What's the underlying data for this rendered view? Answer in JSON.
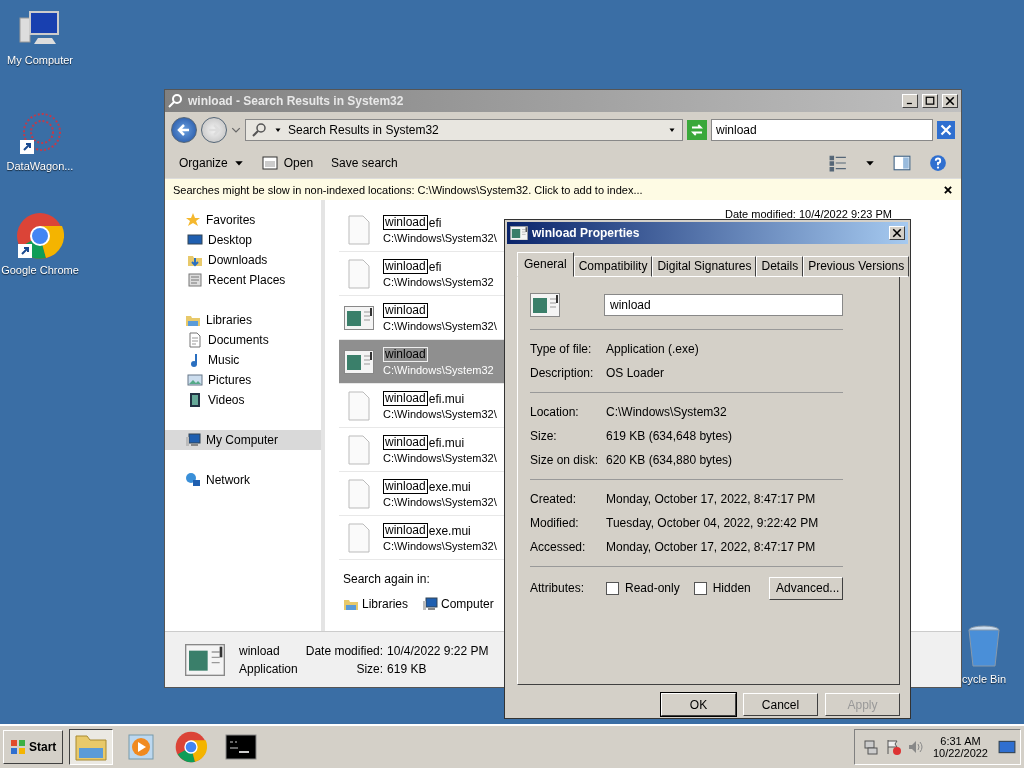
{
  "desktop_icons": [
    {
      "label": "My Computer",
      "kind": "computer"
    },
    {
      "label": "DataWagon...",
      "kind": "datawagon"
    },
    {
      "label": "Google Chrome",
      "kind": "chrome"
    },
    {
      "label": "cycle Bin",
      "kind": "recycle"
    }
  ],
  "explorer": {
    "title": "winload - Search Results in System32",
    "address": "Search Results in System32",
    "search": {
      "value": "winload"
    },
    "toolbar": [
      {
        "label": "Organize",
        "kind": "menu"
      },
      {
        "label": "Open",
        "kind": "icon"
      },
      {
        "label": "Save search",
        "kind": "plain"
      }
    ],
    "info_bar": "Searches might be slow in non-indexed locations: C:\\Windows\\System32. Click to add to index...",
    "nav": [
      {
        "label": "Favorites",
        "kind": "star",
        "selected": false,
        "children": [
          {
            "label": "Desktop",
            "kind": "desktop",
            "selected": false
          },
          {
            "label": "Downloads",
            "kind": "downloads",
            "selected": false
          },
          {
            "label": "Recent Places",
            "kind": "recent",
            "selected": false
          }
        ]
      },
      {
        "label": "Libraries",
        "kind": "library",
        "selected": false,
        "children": [
          {
            "label": "Documents",
            "kind": "documents",
            "selected": false
          },
          {
            "label": "Music",
            "kind": "music",
            "selected": false
          },
          {
            "label": "Pictures",
            "kind": "pictures",
            "selected": false
          },
          {
            "label": "Videos",
            "kind": "videos",
            "selected": false
          }
        ]
      },
      {
        "label": "My Computer",
        "kind": "computer",
        "selected": true
      },
      {
        "label": "Network",
        "kind": "network",
        "selected": false
      }
    ],
    "covered_column": "Date modified: 10/4/2022 9:23 PM",
    "results": [
      {
        "match": "winload",
        "rest": "efi",
        "path": "C:\\Windows\\System32\\",
        "kind": "document",
        "selected": false
      },
      {
        "match": "winload",
        "rest": "efi",
        "path": "C:\\Windows\\System32",
        "kind": "document",
        "selected": false
      },
      {
        "match": "winload",
        "path": "C:\\Windows\\System32\\",
        "kind": "application",
        "selected": false
      },
      {
        "match": "winload",
        "path": "C:\\Windows\\System32",
        "kind": "application",
        "selected": true
      },
      {
        "match": "winload",
        "rest": "efi.mui",
        "path": "C:\\Windows\\System32\\",
        "kind": "document",
        "selected": false
      },
      {
        "match": "winload",
        "rest": "efi.mui",
        "path": "C:\\Windows\\System32\\",
        "kind": "document",
        "selected": false
      },
      {
        "match": "winload",
        "rest": "exe.mui",
        "path": "C:\\Windows\\System32\\",
        "kind": "document",
        "selected": false
      },
      {
        "match": "winload",
        "rest": "exe.mui",
        "path": "C:\\Windows\\System32\\",
        "kind": "document",
        "selected": false
      }
    ],
    "search_again": {
      "label": "Search again in:",
      "places": [
        {
          "label": "Libraries",
          "kind": "library"
        },
        {
          "label": "Computer",
          "kind": "computer"
        }
      ]
    },
    "details": {
      "name": "winload",
      "type": "Application",
      "modified_label": "Date modified:",
      "modified": "10/4/2022 9:22 PM",
      "size_label": "Size:",
      "size": "619 KB"
    }
  },
  "dialog": {
    "title": "winload Properties",
    "tabs": [
      {
        "label": "General",
        "selected": true
      },
      {
        "label": "Compatibility",
        "selected": false
      },
      {
        "label": "Digital Signatures",
        "selected": false
      },
      {
        "label": "Details",
        "selected": false
      },
      {
        "label": "Previous Versions",
        "selected": false
      }
    ],
    "name_field": {
      "value": "winload"
    },
    "groups": [
      [
        {
          "label": "Type of file:",
          "value": "Application (.exe)"
        },
        {
          "label": "Description:",
          "value": "OS Loader"
        }
      ],
      [
        {
          "label": "Location:",
          "value": "C:\\Windows\\System32"
        },
        {
          "label": "Size:",
          "value": "619 KB (634,648 bytes)"
        },
        {
          "label": "Size on disk:",
          "value": "620 KB (634,880 bytes)"
        }
      ],
      [
        {
          "label": "Created:",
          "value": "Monday, October 17, 2022, 8:47:17 PM"
        },
        {
          "label": "Modified:",
          "value": "Tuesday, October 04, 2022, 9:22:42 PM"
        },
        {
          "label": "Accessed:",
          "value": "Monday, October 17, 2022, 8:47:17 PM"
        }
      ]
    ],
    "attributes": {
      "label": "Attributes:",
      "options": [
        {
          "label": "Read-only",
          "checked": false
        },
        {
          "label": "Hidden",
          "checked": false
        }
      ],
      "advanced": "Advanced..."
    },
    "buttons": [
      {
        "label": "OK",
        "disabled": false
      },
      {
        "label": "Cancel",
        "disabled": false
      },
      {
        "label": "Apply",
        "disabled": true
      }
    ]
  },
  "taskbar": {
    "start": "Start",
    "apps": [
      {
        "kind": "explorer",
        "selected": true
      },
      {
        "kind": "media",
        "selected": false
      },
      {
        "kind": "chrome",
        "selected": false
      },
      {
        "kind": "console",
        "selected": false
      }
    ],
    "time": "6:31 AM",
    "date": "10/22/2022"
  }
}
